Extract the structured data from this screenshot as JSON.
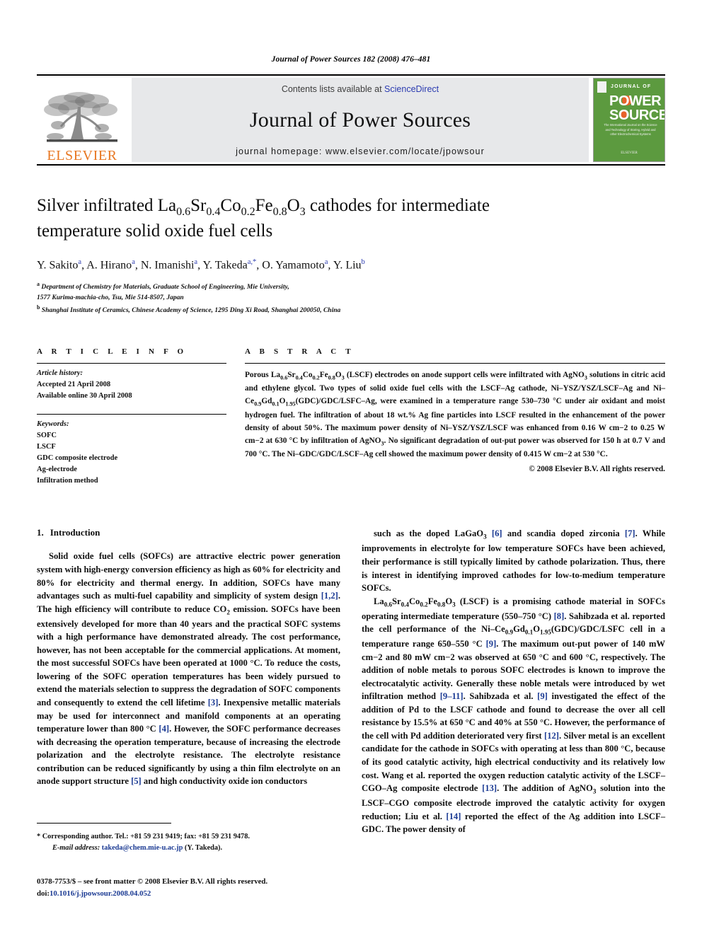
{
  "running_head": "Journal of Power Sources 182 (2008) 476–481",
  "masthead": {
    "publisher_name": "ELSEVIER",
    "contents_prefix": "Contents lists available at ",
    "contents_link": "ScienceDirect",
    "journal_title": "Journal of Power Sources",
    "homepage": "journal homepage: www.elsevier.com/locate/jpowsour",
    "cover": {
      "line_journal_of": "JOURNAL OF",
      "line_power": "POWER",
      "line_sources": "SOURCES",
      "blurb": "The International Journal on the Science and Technology of Storing, Hybrid and other Electrochemical Systems",
      "bottom_mark": "ELSEVIER"
    }
  },
  "article": {
    "title_line1_a": "Silver infiltrated La",
    "title_sub1": "0.6",
    "title_line1_b": "Sr",
    "title_sub2": "0.4",
    "title_line1_c": "Co",
    "title_sub3": "0.2",
    "title_line1_d": "Fe",
    "title_sub4": "0.8",
    "title_line1_e": "O",
    "title_sub5": "3",
    "title_line1_f": " cathodes for intermediate temperature solid oxide fuel cells",
    "authors": "Y. Sakito a, A. Hirano a, N. Imanishi a, Y. Takeda a,*, O. Yamamoto a, Y. Liu b",
    "affiliation_a_line1": "Department of Chemistry for Materials, Graduate School of Engineering, Mie University,",
    "affiliation_a_line2": "1577 Kurima-machia-cho, Tsu, Mie 514-8507, Japan",
    "affiliation_b": "Shanghai Institute of Ceramics, Chinese Academy of Science, 1295 Ding Xi Road, Shanghai 200050, China"
  },
  "article_info": {
    "heading": "A R T I C L E   I N F O",
    "history_label": "Article history:",
    "history_items": [
      "Accepted 21 April 2008",
      "Available online 30 April 2008"
    ],
    "keywords_label": "Keywords:",
    "keywords": [
      "SOFC",
      "LSCF",
      "GDC composite electrode",
      "Ag-electrode",
      "Infiltration method"
    ]
  },
  "abstract": {
    "heading": "A B S T R A C T",
    "text": "Porous La0.6Sr0.4Co0.2Fe0.8O3 (LSCF) electrodes on anode support cells were infiltrated with AgNO3 solutions in citric acid and ethylene glycol. Two types of solid oxide fuel cells with the LSCF–Ag cathode, Ni–YSZ/YSZ/LSCF–Ag and Ni–Ce0.9Gd0.1O1.95(GDC)/GDC/LSFC–Ag, were examined in a temperature range 530–730 °C under air oxidant and moist hydrogen fuel. The infiltration of about 18 wt.% Ag fine particles into LSCF resulted in the enhancement of the power density of about 50%. The maximum power density of Ni–YSZ/YSZ/LSCF was enhanced from 0.16 W cm−2 to 0.25 W cm−2 at 630 °C by infiltration of AgNO3. No significant degradation of out-put power was observed for 150 h at 0.7 V and 700 °C. The Ni–GDC/GDC/LSCF–Ag cell showed the maximum power density of 0.415 W cm−2 at 530 °C.",
    "copyright": "© 2008 Elsevier B.V. All rights reserved."
  },
  "section": {
    "number": "1.",
    "heading": "Introduction"
  },
  "body": {
    "left_paragraph_1": "Solid oxide fuel cells (SOFCs) are attractive electric power generation system with high-energy conversion efficiency as high as 60% for electricity and 80% for electricity and thermal energy. In addition, SOFCs have many advantages such as multi-fuel capability and simplicity of system design [1,2]. The high efficiency will contribute to reduce CO2 emission. SOFCs have been extensively developed for more than 40 years and the practical SOFC systems with a high performance have demonstrated already. The cost performance, however, has not been acceptable for the commercial applications. At moment, the most successful SOFCs have been operated at 1000 °C. To reduce the costs, lowering of the SOFC operation temperatures has been widely pursued to extend the materials selection to suppress the degradation of SOFC components and consequently to extend the cell lifetime [3]. Inexpensive metallic materials may be used for interconnect and manifold components at an operating temperature lower than 800 °C [4]. However, the SOFC performance decreases with decreasing the operation temperature, because of increasing the electrode polarization and the electrolyte resistance. The electrolyte resistance contribution can be reduced significantly by using a thin film electrolyte on an anode support structure [5] and high conductivity oxide ion conductors",
    "right_paragraph_1": "such as the doped LaGaO3 [6] and scandia doped zirconia [7]. While improvements in electrolyte for low temperature SOFCs have been achieved, their performance is still typically limited by cathode polarization. Thus, there is interest in identifying improved cathodes for low-to-medium temperature SOFCs.",
    "right_paragraph_2": "La0.6Sr0.4Co0.2Fe0.8O3 (LSCF) is a promising cathode material in SOFCs operating intermediate temperature (550–750 °C) [8]. Sahibzada et al. reported the cell performance of the Ni–Ce0.9Gd0.1O1.95(GDC)/GDC/LSFC cell in a temperature range 650–550 °C [9]. The maximum out-put power of 140 mW cm−2 and 80 mW cm−2 was observed at 650 °C and 600 °C, respectively. The addition of noble metals to porous SOFC electrodes is known to improve the electrocatalytic activity. Generally these noble metals were introduced by wet infiltration method [9–11]. Sahibzada et al. [9] investigated the effect of the addition of Pd to the LSCF cathode and found to decrease the over all cell resistance by 15.5% at 650 °C and 40% at 550 °C. However, the performance of the cell with Pd addition deteriorated very first [12]. Silver metal is an excellent candidate for the cathode in SOFCs with operating at less than 800 °C, because of its good catalytic activity, high electrical conductivity and its relatively low cost. Wang et al. reported the oxygen reduction catalytic activity of the LSCF–CGO–Ag composite electrode [13]. The addition of AgNO3 solution into the LSCF–CGO composite electrode improved the catalytic activity for oxygen reduction; Liu et al. [14] reported the effect of the Ag addition into LSCF–GDC. The power density of"
  },
  "footnote": {
    "corresponding": "* Corresponding author. Tel.: +81 59 231 9419; fax: +81 59 231 9478.",
    "email_label": "E-mail address:",
    "email": "takeda@chem.mie-u.ac.jp",
    "email_suffix": "(Y. Takeda)."
  },
  "footer": {
    "issn_line": "0378-7753/$ – see front matter © 2008 Elsevier B.V. All rights reserved.",
    "doi_label": "doi:",
    "doi_value": "10.1016/j.jpowsour.2008.04.052"
  },
  "colors": {
    "link": "#1b3a93",
    "sciencedirect": "#2b3bb0",
    "elsevier_orange": "#E87722",
    "cover_green": "#5c9a3f",
    "banner_gray": "#e7e8ea"
  }
}
